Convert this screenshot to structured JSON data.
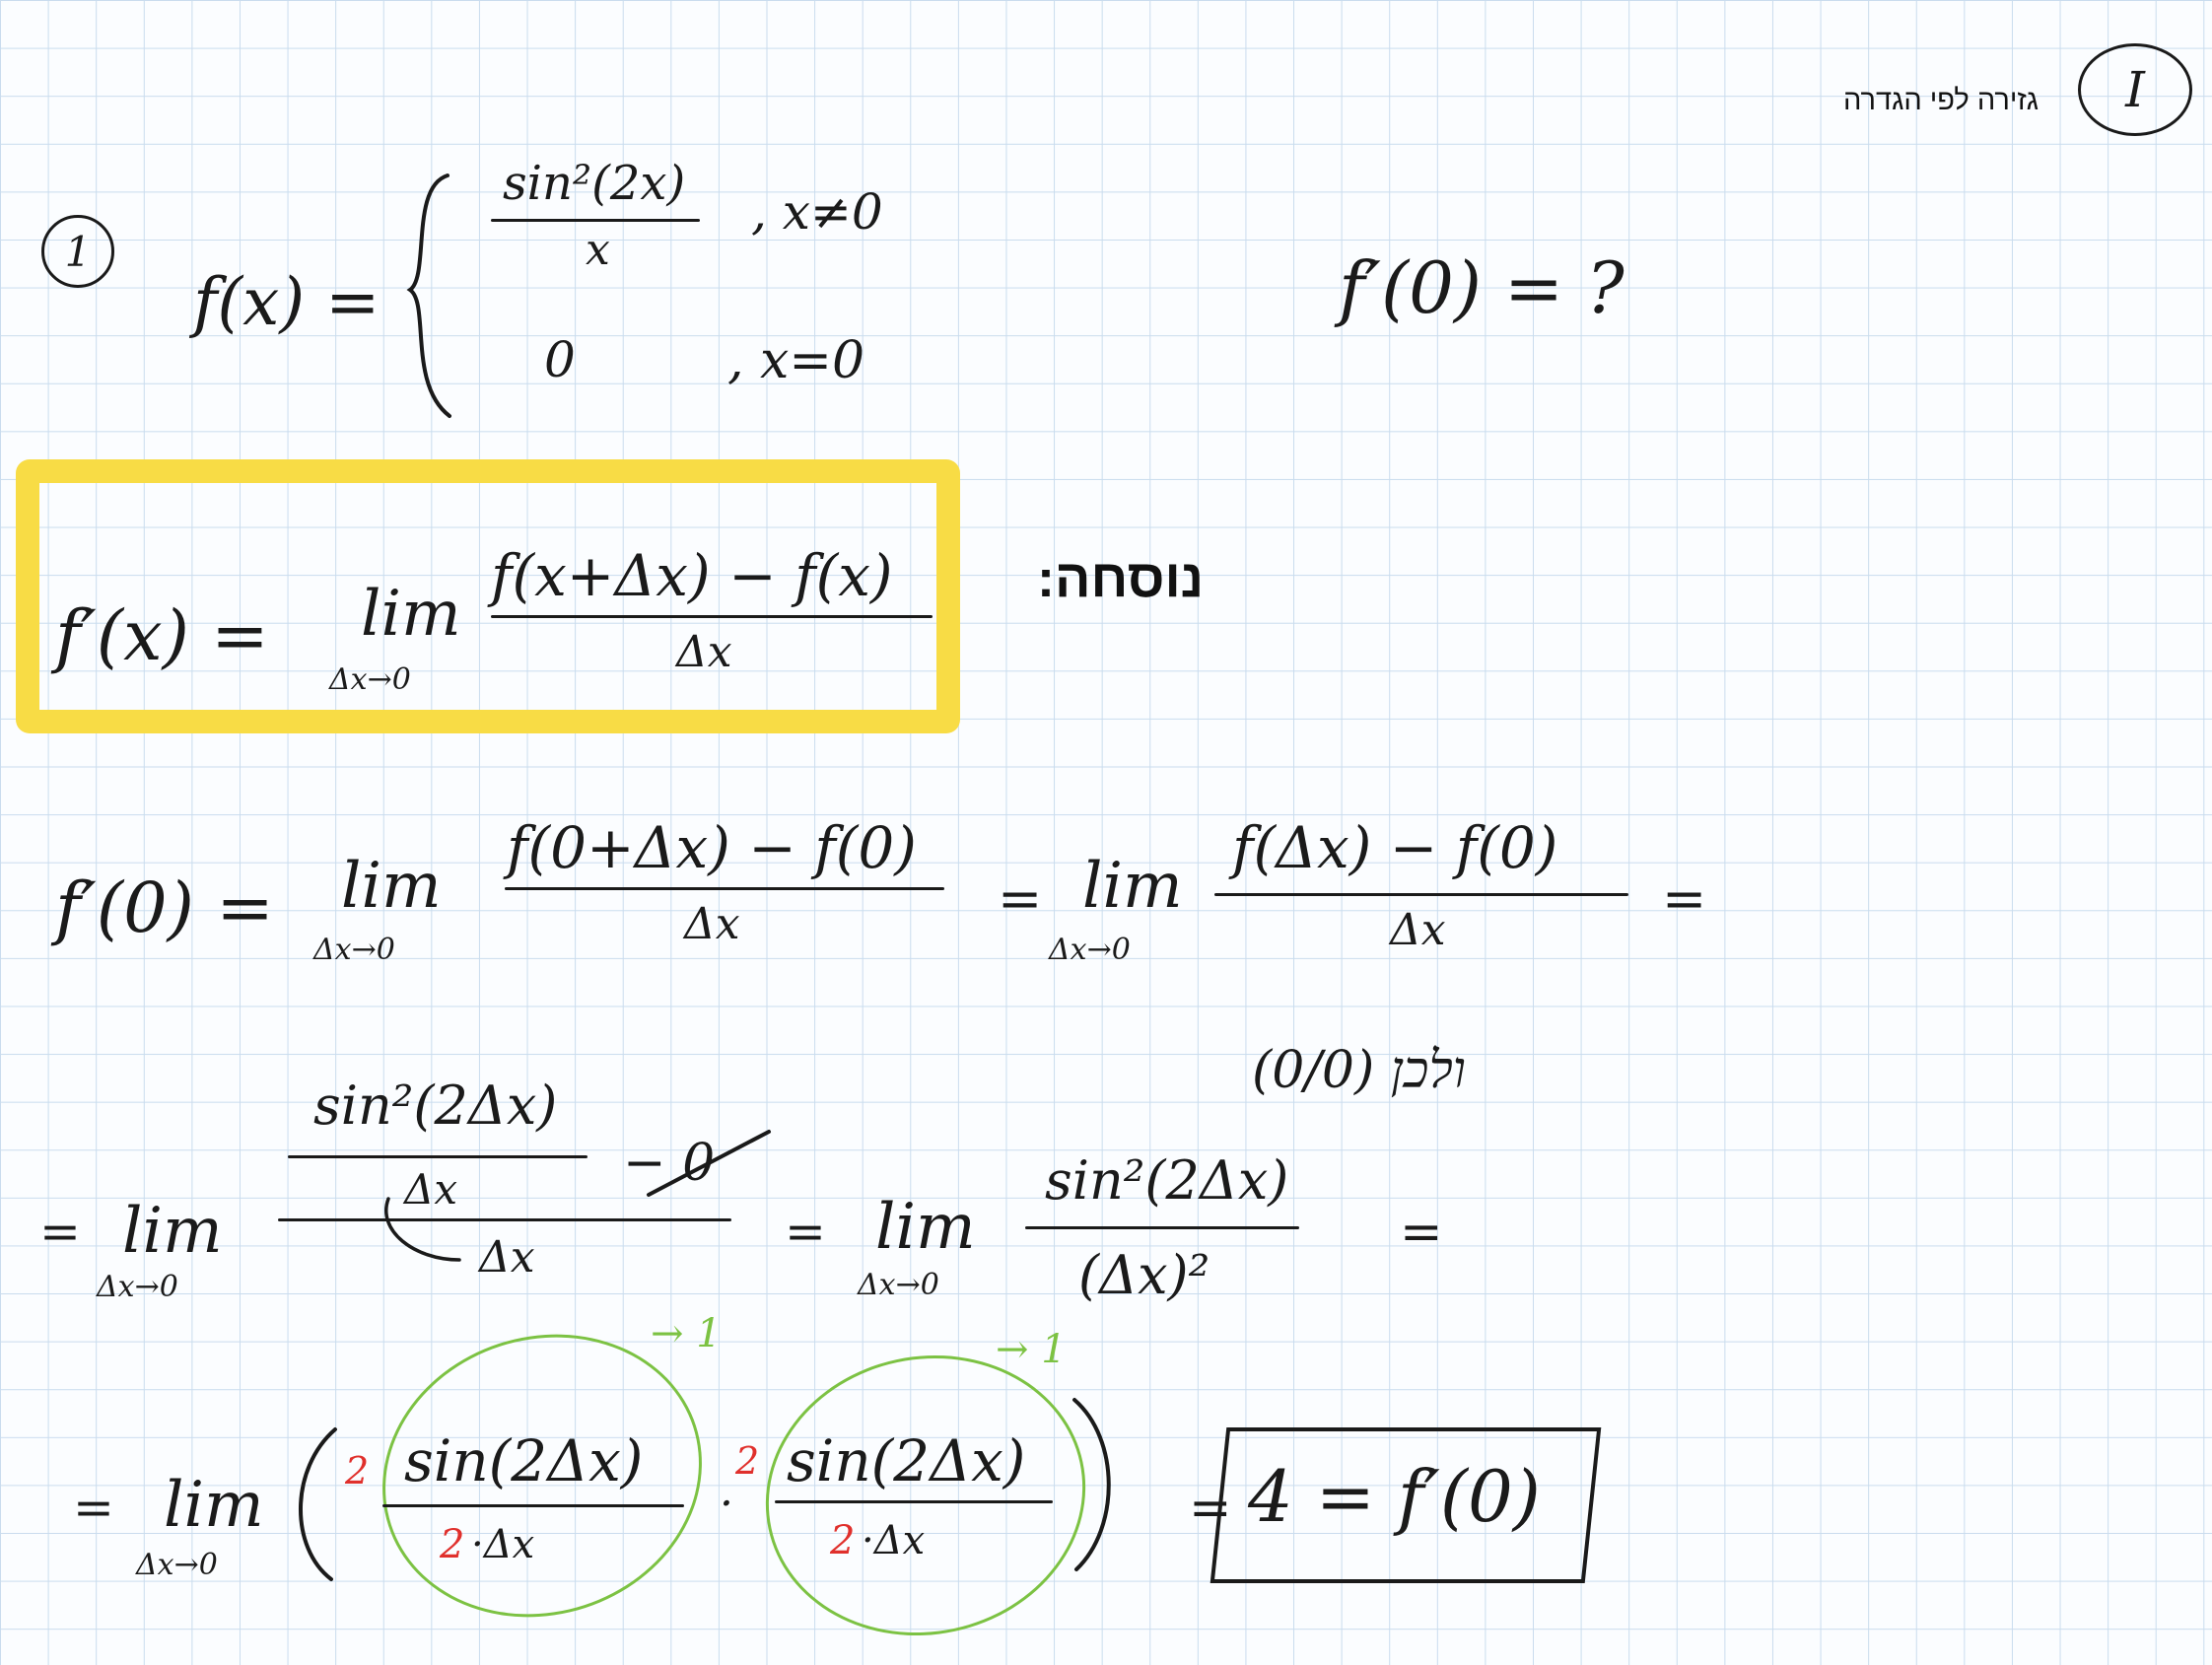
{
  "header": {
    "title": "גזירה לפי הגדרה",
    "section_number": "I"
  },
  "problem": {
    "number": "1",
    "func_lhs": "f(x) =",
    "case1_num": "sin²(2x)",
    "case1_den": "x",
    "case1_cond": ", x≠0",
    "case2_val": "0",
    "case2_cond": ", x=0",
    "question": "f′(0) = ?"
  },
  "formula": {
    "label": "נוסחה:",
    "lhs": "f′(x) =",
    "lim": "lim",
    "lim_sub": "Δx→0",
    "num": "f(x+Δx) − f(x)",
    "den": "Δx"
  },
  "step1": {
    "lhs": "f′(0) =",
    "lim": "lim",
    "lim_sub": "Δx→0",
    "num": "f(0+Δx) − f(0)",
    "den": "Δx",
    "eq2": "=",
    "lim2": "lim",
    "lim2_sub": "Δx→0",
    "num2": "f(Δx) − f(0)",
    "den2": "Δx",
    "eq3": "="
  },
  "step2": {
    "eq1": "=",
    "lim": "lim",
    "lim_sub": "Δx→0",
    "inner_num": "sin²(2Δx)",
    "inner_den": "Δx",
    "minus_zero": "− 0",
    "outer_den": "Δx",
    "eq2": "=",
    "lim2": "lim",
    "lim2_sub": "Δx→0",
    "num2": "sin²(2Δx)",
    "den2": "(Δx)²",
    "eq3": "=",
    "note": "(0/0) ולכן"
  },
  "step3": {
    "eq1": "=",
    "lim": "lim",
    "lim_sub": "Δx→0",
    "factor_red": "2",
    "num_a": "sin(2Δx)",
    "den_red": "2",
    "den_a": "·Δx",
    "dot": "·",
    "factor_red2": "2",
    "num_b": "sin(2Δx)",
    "den_red2": "2",
    "den_b": "·Δx",
    "arrow_a": "→ 1",
    "arrow_b": "→ 1",
    "eq2": "=",
    "result": "4 = f′(0)"
  }
}
